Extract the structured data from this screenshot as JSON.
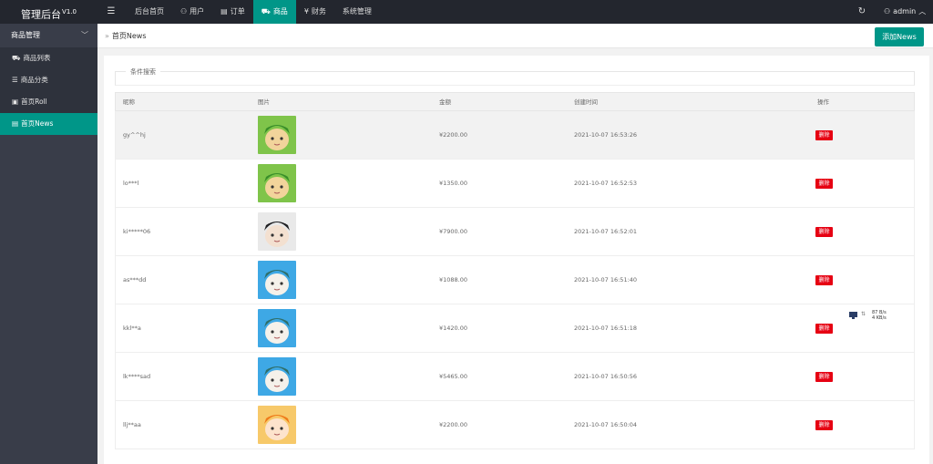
{
  "app": {
    "title": "管理后台",
    "version": "V1.0"
  },
  "topnav": [
    {
      "label": "后台首页",
      "icon": "",
      "active": false
    },
    {
      "label": "用户",
      "icon": "user-icon",
      "active": false
    },
    {
      "label": "订单",
      "icon": "document-icon",
      "active": false
    },
    {
      "label": "商品",
      "icon": "cart-icon",
      "active": true
    },
    {
      "label": "财务",
      "icon": "yen-icon",
      "active": false
    },
    {
      "label": "系统管理",
      "icon": "",
      "active": false
    }
  ],
  "user": {
    "name": "admin"
  },
  "sidebar": {
    "group": "商品管理",
    "items": [
      {
        "label": "商品列表",
        "icon": "cart-icon",
        "active": false
      },
      {
        "label": "商品分类",
        "icon": "layers-icon",
        "active": false
      },
      {
        "label": "首页Roll",
        "icon": "box-icon",
        "active": false
      },
      {
        "label": "首页News",
        "icon": "doc-icon",
        "active": true
      }
    ]
  },
  "breadcrumb": {
    "label": "首页News"
  },
  "add_button": "添加News",
  "search": {
    "legend": "条件搜索"
  },
  "table": {
    "headers": {
      "nick": "昵称",
      "img": "图片",
      "amount": "金额",
      "time": "创建时间",
      "op": "操作"
    },
    "rows": [
      {
        "nick": "gy^^hj",
        "amount": "¥2200.00",
        "time": "2021-10-07 16:53:26",
        "op": "删除",
        "img": "green"
      },
      {
        "nick": "lo***l",
        "amount": "¥1350.00",
        "time": "2021-10-07 16:52:53",
        "op": "删除",
        "img": "green"
      },
      {
        "nick": "ki*****06",
        "amount": "¥7900.00",
        "time": "2021-10-07 16:52:01",
        "op": "删除",
        "img": "dark"
      },
      {
        "nick": "as***dd",
        "amount": "¥1088.00",
        "time": "2021-10-07 16:51:40",
        "op": "删除",
        "img": "blue"
      },
      {
        "nick": "kkl**a",
        "amount": "¥1420.00",
        "time": "2021-10-07 16:51:18",
        "op": "删除",
        "img": "blue"
      },
      {
        "nick": "lk****sad",
        "amount": "¥5465.00",
        "time": "2021-10-07 16:50:56",
        "op": "删除",
        "img": "blue"
      },
      {
        "nick": "llj**aa",
        "amount": "¥2200.00",
        "time": "2021-10-07 16:50:04",
        "op": "删除",
        "img": "orange"
      }
    ]
  },
  "net_speed": {
    "up": "87 B/s",
    "down": "4 KB/s"
  },
  "colors": {
    "accent": "#009688",
    "danger": "#e60012",
    "topbar": "#23262e",
    "sidebar": "#393d49"
  }
}
